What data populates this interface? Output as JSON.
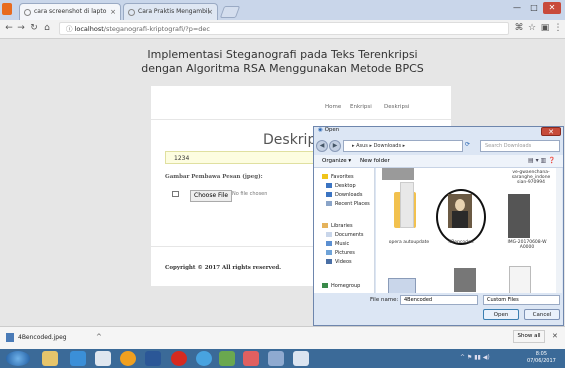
{
  "browser": {
    "tabs": [
      {
        "label": "cara screenshot di lapto",
        "close": "×"
      },
      {
        "label": "Cara Praktis Mengambil",
        "close": "×"
      }
    ],
    "window_controls": [
      "—",
      "□",
      "✕"
    ],
    "url_host": "localhost",
    "url_path": "/steganografi-kriptografi/?p=dec",
    "nav_icons": [
      "back-icon",
      "forward-icon",
      "reload-icon",
      "home-icon",
      "info-icon",
      "translate-icon",
      "star-icon",
      "extension-icon",
      "menu-icon"
    ]
  },
  "page": {
    "title_line1": "Implementasi Steganografi pada Teks Terenkripsi",
    "title_line2": "dengan Algoritma RSA Menggunakan Metode BPCS",
    "nav": [
      "Home",
      "Enkripsi",
      "Deskripsi"
    ],
    "heading": "Deskripsi",
    "key_value": "1234",
    "image_label": "Gambar Pembawa Pesan (jpeg):",
    "choose_file": "Choose File",
    "no_file": "No file chosen",
    "copyright": "Copyright © 2017 All rights reserved."
  },
  "dialog": {
    "title": "Open",
    "close": "✕",
    "breadcrumb": "▸ Asus ▸ Downloads ▸",
    "search_placeholder": "Search Downloads",
    "organize": "Organize ▾",
    "new_folder": "New folder",
    "favorites": {
      "header": "Favorites",
      "items": [
        "Desktop",
        "Downloads",
        "Recent Places"
      ]
    },
    "libraries": {
      "header": "Libraries",
      "items": [
        "Documents",
        "Music",
        "Pictures",
        "Videos"
      ]
    },
    "homegroup": "Homegroup",
    "files": [
      {
        "name": "ve-gwaenchana-saranghe_indone sian-970994"
      },
      {
        "name": "opera autoupdate"
      },
      {
        "name": "4Bencoded"
      },
      {
        "name": "IMG-20170608-W A0000"
      }
    ],
    "filename_label": "File name:",
    "filename_value": "4Bencoded",
    "filter_value": "Custom Files",
    "open_button": "Open",
    "cancel_button": "Cancel"
  },
  "download_bar": {
    "file": "4Bencoded.jpeg",
    "chevron": "^",
    "show_all": "Show all",
    "close": "✕"
  },
  "taskbar": {
    "clock_time": "8:05",
    "clock_date": "07/06/2017"
  }
}
